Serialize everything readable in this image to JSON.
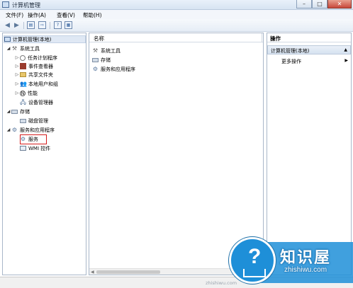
{
  "window": {
    "title": "计算机管理"
  },
  "menu": [
    "文件(F)",
    "操作(A)",
    "查看(V)",
    "帮助(H)"
  ],
  "toolbar": {
    "back": "◀",
    "forward": "▶",
    "show_hide_tree": "▤",
    "export": "⇨",
    "help": "?",
    "properties": "▦"
  },
  "tree": {
    "root": "计算机管理(本地)",
    "system_tools": "系统工具",
    "task_scheduler": "任务计划程序",
    "event_viewer": "事件查看器",
    "shared_folders": "共享文件夹",
    "local_users": "本地用户和组",
    "performance": "性能",
    "device_manager": "设备管理器",
    "storage": "存储",
    "disk_management": "磁盘管理",
    "services_apps": "服务和应用程序",
    "services": "服务",
    "wmi": "WMI 控件"
  },
  "content": {
    "column_name": "名称",
    "items": [
      "系统工具",
      "存储",
      "服务和应用程序"
    ]
  },
  "actions": {
    "header": "操作",
    "section": "计算机管理(本地)",
    "more": "更多操作"
  },
  "watermark": {
    "brand_cn": "知识屋",
    "brand_en": "zhishiwu.com",
    "url": "zhishiwu.com"
  },
  "colors": {
    "highlight": "#d41a1a",
    "logo_blue": "#1e8fd8"
  }
}
